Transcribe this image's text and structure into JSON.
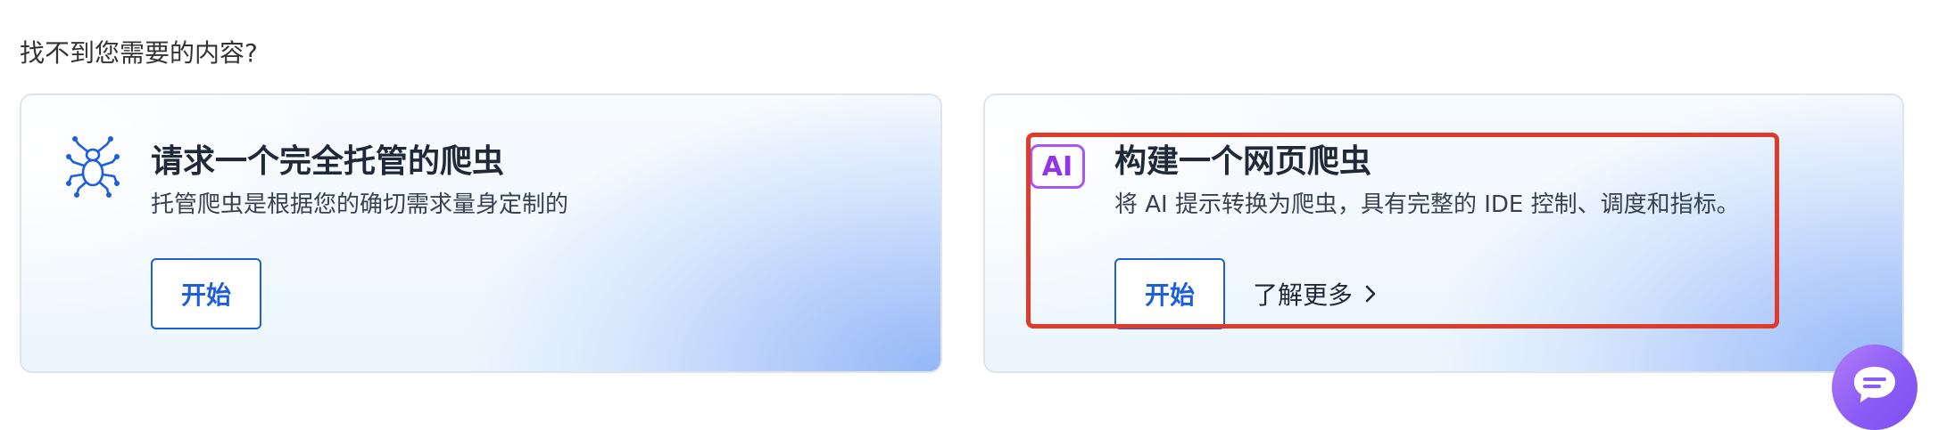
{
  "heading": "找不到您需要的内容?",
  "cards": [
    {
      "icon": "spider-icon",
      "title": "请求一个完全托管的爬虫",
      "description": "托管爬虫是根据您的确切需求量身定制的",
      "button_label": "开始"
    },
    {
      "icon": "ai-icon",
      "icon_text": "AI",
      "title": "构建一个网页爬虫",
      "description": "将 AI 提示转换为爬虫，具有完整的 IDE 控制、调度和指标。",
      "button_label": "开始",
      "learn_more_label": "了解更多"
    }
  ],
  "colors": {
    "accent": "#1d5fd8",
    "highlight": "#e03a2b",
    "ai_purple": "#a855f7",
    "chat_purple": "#8b5cf6"
  },
  "chat": {
    "icon": "chat-bubble-icon"
  }
}
